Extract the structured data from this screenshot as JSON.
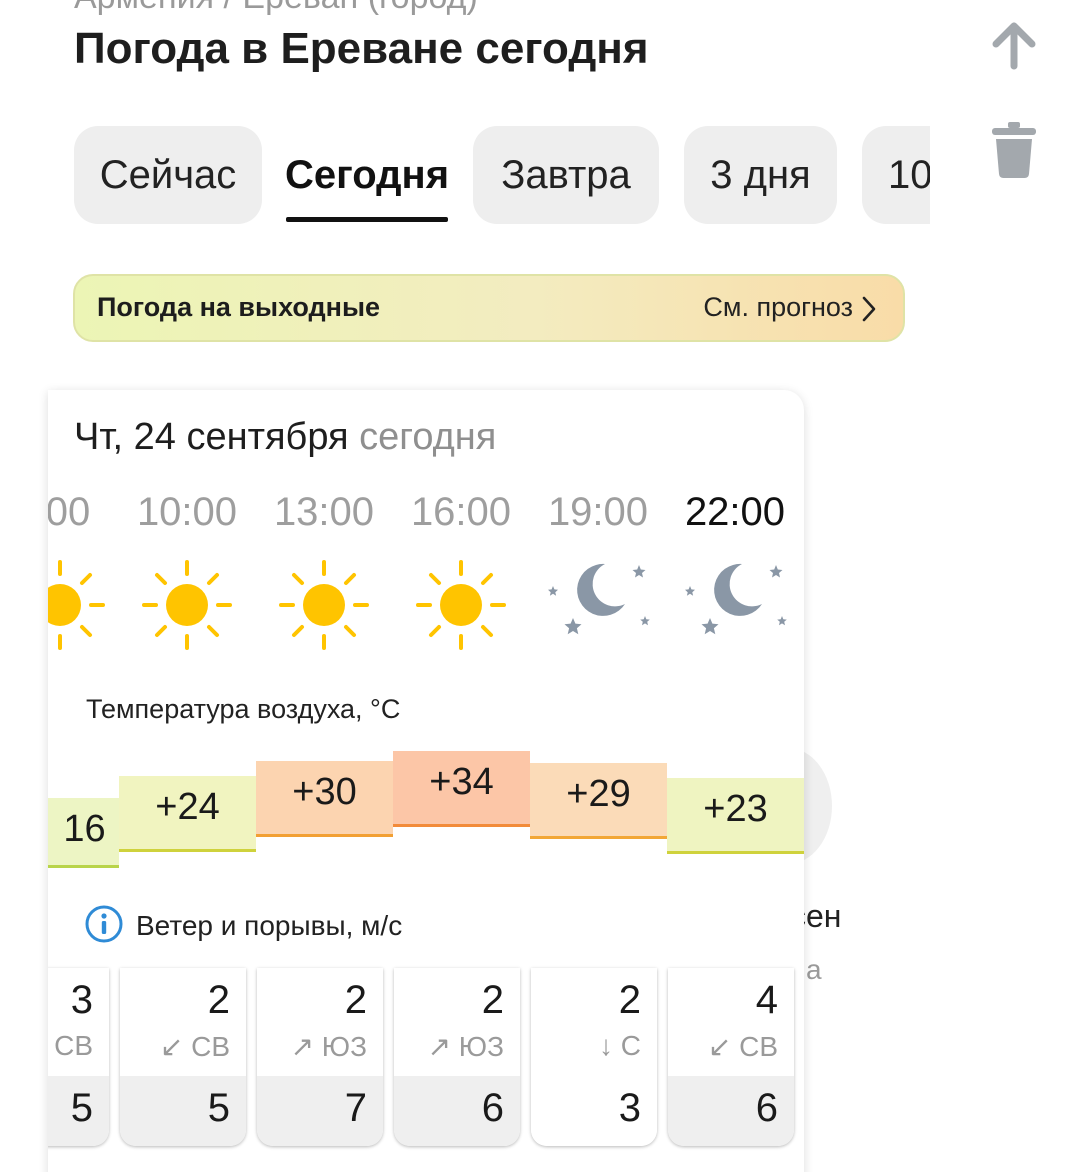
{
  "header": {
    "breadcrumb": "Армения / Ереван (город)",
    "title": "Погода в Ереване сегодня"
  },
  "tabs": [
    {
      "label": "Сейчас",
      "active": false
    },
    {
      "label": "Сегодня",
      "active": true
    },
    {
      "label": "Завтра",
      "active": false
    },
    {
      "label": "3 дня",
      "active": false
    },
    {
      "label": "10",
      "active": false
    }
  ],
  "banner": {
    "title": "Погода на выходные",
    "link": "См. прогноз"
  },
  "background_text": {
    "line1": "сен",
    "line2": "а"
  },
  "day": {
    "date": "Чт, 24 сентября",
    "relative": "сегодня"
  },
  "hours": [
    {
      "time": "00",
      "icon": "sun-icon"
    },
    {
      "time": "10:00",
      "icon": "sun-icon"
    },
    {
      "time": "13:00",
      "icon": "sun-icon"
    },
    {
      "time": "16:00",
      "icon": "sun-icon"
    },
    {
      "time": "19:00",
      "icon": "moon-stars-icon"
    },
    {
      "time": "22:00",
      "icon": "moon-stars-icon",
      "current": true
    }
  ],
  "temperature": {
    "label": "Температура воздуха, °C",
    "values": [
      "16",
      "+24",
      "+30",
      "+34",
      "+29",
      "+23"
    ],
    "celsius": [
      16,
      24,
      30,
      34,
      29,
      23
    ]
  },
  "wind": {
    "label": "Ветер и порывы, м/с",
    "items": [
      {
        "speed": "3",
        "direction": "СВ",
        "gust": "5"
      },
      {
        "speed": "2",
        "direction": "↙ СВ",
        "gust": "5"
      },
      {
        "speed": "2",
        "direction": "↗ ЮЗ",
        "gust": "7"
      },
      {
        "speed": "2",
        "direction": "↗ ЮЗ",
        "gust": "6"
      },
      {
        "speed": "2",
        "direction": "↓ С",
        "gust": "3"
      },
      {
        "speed": "4",
        "direction": "↙ СВ",
        "gust": "6"
      }
    ]
  },
  "colors": {
    "sun": "#ffc400",
    "moon": "#8a97a6",
    "temp_warm": "#f9c98c",
    "temp_mild": "#f2f5b8",
    "temp_hot": "#fbc3a0"
  }
}
